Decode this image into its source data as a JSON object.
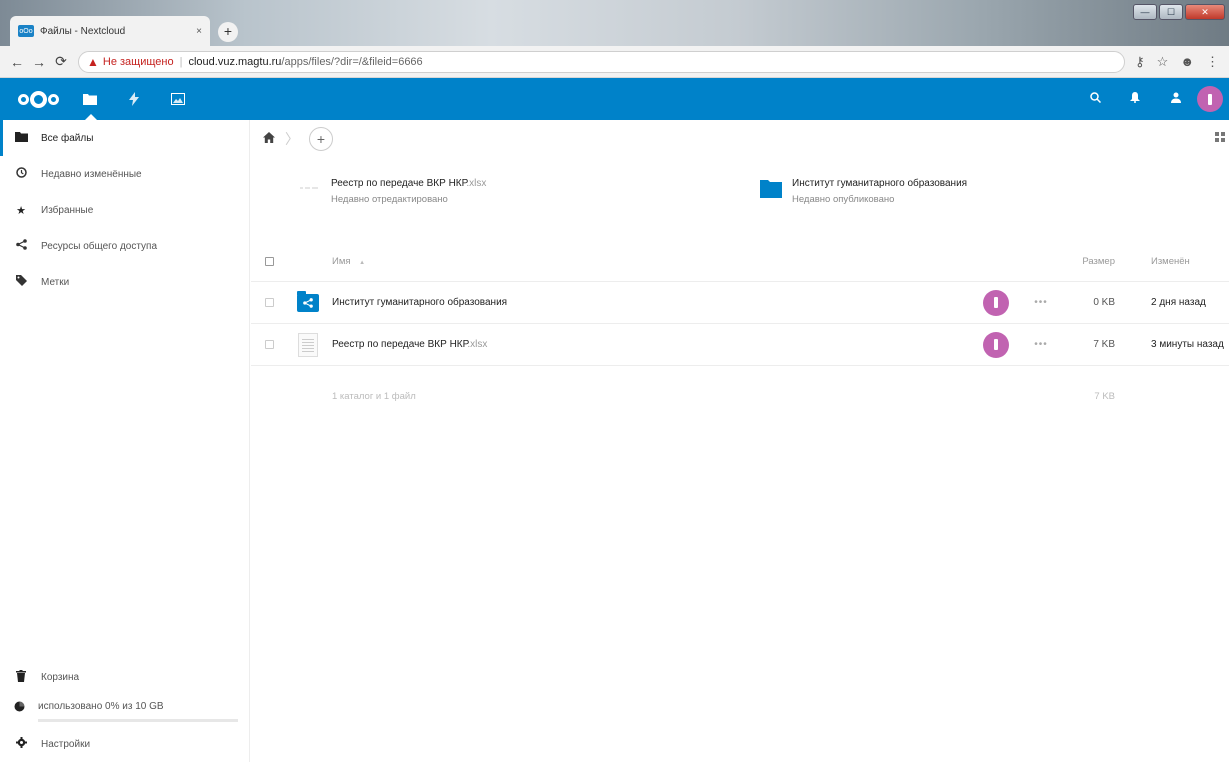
{
  "browser": {
    "tab_title": "Файлы - Nextcloud",
    "tab_close": "×",
    "new_tab": "+",
    "security_label": "Не защищено",
    "url_host": "cloud.vuz.magtu.ru",
    "url_path": "/apps/files/?dir=/&fileid=6666",
    "window_controls": {
      "minimize": "—",
      "maximize": "☐",
      "close": "✕"
    }
  },
  "header": {
    "apps": [
      "files-icon",
      "activity-icon",
      "gallery-icon"
    ],
    "accent_color": "#0082c9"
  },
  "sidebar": {
    "items": [
      {
        "label": "Все файлы",
        "icon": "folder-icon"
      },
      {
        "label": "Недавно изменённые",
        "icon": "clock-icon"
      },
      {
        "label": "Избранные",
        "icon": "star-icon"
      },
      {
        "label": "Ресурсы общего доступа",
        "icon": "share-icon"
      },
      {
        "label": "Метки",
        "icon": "tag-icon"
      }
    ],
    "trash_label": "Корзина",
    "quota_label": "использовано 0% из 10 GB",
    "quota_used_fraction": 0.0,
    "settings_label": "Настройки"
  },
  "recent": [
    {
      "name": "Реестр по передаче ВКР НКР",
      "ext": ".xlsx",
      "sub": "Недавно отредактировано"
    },
    {
      "name": "Институт гуманитарного образования",
      "ext": "",
      "sub": "Недавно опубликовано"
    }
  ],
  "table": {
    "col_name": "Имя",
    "sort_indicator": "▲",
    "col_size": "Размер",
    "col_modified": "Изменён",
    "rows": [
      {
        "name": "Институт гуманитарного образования",
        "ext": "",
        "size": "0 KB",
        "modified": "2 дня назад"
      },
      {
        "name": "Реестр по передаче ВКР НКР",
        "ext": ".xlsx",
        "size": "7 KB",
        "modified": "3 минуты назад"
      }
    ],
    "summary": "1 каталог и 1 файл",
    "summary_size": "7 KB"
  }
}
